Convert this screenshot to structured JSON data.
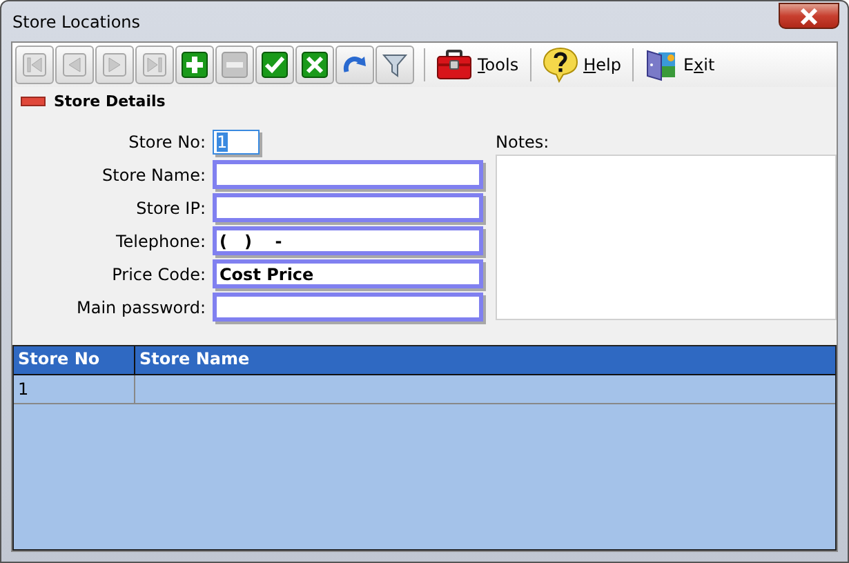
{
  "window": {
    "title": "Store Locations"
  },
  "toolbar": {
    "nav_buttons": [
      {
        "kind": "first",
        "disabled": true
      },
      {
        "kind": "prev",
        "disabled": true
      },
      {
        "kind": "next",
        "disabled": true
      },
      {
        "kind": "last",
        "disabled": true
      },
      {
        "kind": "add",
        "disabled": false
      },
      {
        "kind": "delete",
        "disabled": true
      },
      {
        "kind": "save",
        "disabled": false
      },
      {
        "kind": "cancel",
        "disabled": false
      },
      {
        "kind": "refresh",
        "disabled": false
      },
      {
        "kind": "filter",
        "disabled": false
      }
    ],
    "text_buttons": [
      {
        "kind": "tools",
        "key": "T",
        "after": "ools"
      },
      {
        "kind": "help",
        "key": "H",
        "after": "elp"
      },
      {
        "kind": "exit",
        "before": "E",
        "key": "x",
        "after": "it"
      }
    ]
  },
  "section": {
    "title": "Store Details"
  },
  "form": {
    "fields": [
      {
        "label": "Store No:",
        "value": "1",
        "kind": "short",
        "selected_text": true
      },
      {
        "label": "Store Name:",
        "kind": "wide",
        "selected_text": false
      },
      {
        "label": "Store IP:",
        "kind": "wide",
        "selected_text": false
      },
      {
        "label": "Telephone:",
        "value": "(   )    -",
        "kind": "wide",
        "selected_text": false
      },
      {
        "label": "Price Code:",
        "value": "Cost Price",
        "kind": "wide",
        "selected_text": false
      },
      {
        "label": "Main password:",
        "kind": "wide",
        "selected_text": false
      }
    ],
    "notes": {
      "label": "Notes:"
    }
  },
  "grid": {
    "columns": [
      "Store No",
      "Store Name"
    ],
    "rows": [
      [
        "1",
        ""
      ]
    ]
  }
}
